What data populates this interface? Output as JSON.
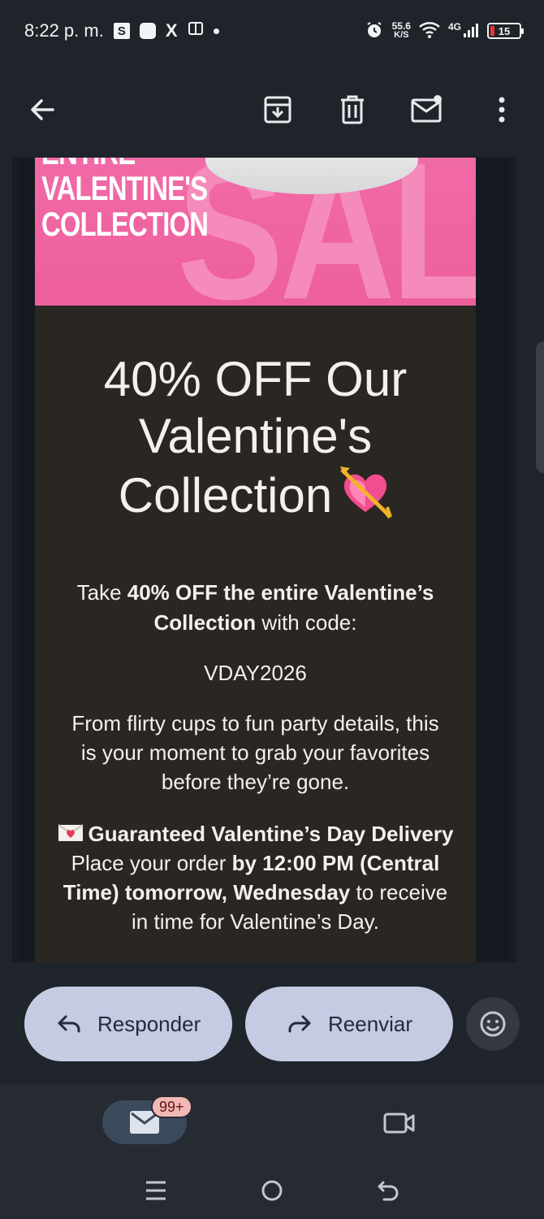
{
  "status_bar": {
    "time": "8:22 p. m.",
    "notif_s": "S",
    "notif_x": "X",
    "speed_value": "55.6",
    "speed_unit": "K/S",
    "network": "4G",
    "battery": "15"
  },
  "hero": {
    "line0": "ENTIRE",
    "line1": "VALENTINE'S",
    "line2": "COLLECTION",
    "background_word": "SALE"
  },
  "email": {
    "headline": "40% OFF Our Valentine's Collection",
    "p1_pre": "Take ",
    "p1_bold": "40% OFF the entire Valentine’s Collection",
    "p1_post": " with code:",
    "code": "VDAY2026",
    "p2": "From flirty cups to fun party details, this is your moment to grab your favorites before they’re gone.",
    "p3_title": "Guaranteed Valentine’s Day Delivery",
    "p3_pre": "Place your order ",
    "p3_bold": "by 12:00 PM (Central Time) tomorrow, Wednesday",
    "p3_post": " to receive in time for Valentine’s Day."
  },
  "actions": {
    "reply_label": "Responder",
    "forward_label": "Reenviar"
  },
  "bottom_nav": {
    "mail_badge": "99+"
  },
  "colors": {
    "accent_pill": "#c5cbe3",
    "hero_pink": "#ee5f9d",
    "card_bg": "#2a2621"
  }
}
